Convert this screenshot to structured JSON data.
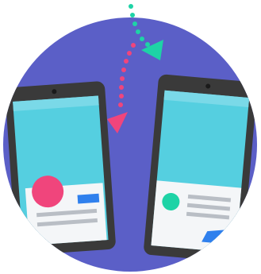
{
  "illustration": {
    "subject": "two-phones-sync",
    "colors": {
      "background": "#ffffff",
      "circle": "#5b5fc7",
      "phone_body": "#3a3a3a",
      "screen": "#55cfe0",
      "card": "#f4f6f8",
      "card_line": "#b9bec5",
      "pink": "#f0457c",
      "teal": "#1ed3a6",
      "blue": "#2f80ed"
    },
    "icons": {
      "arrow_down": "pink-dotted-arrow-icon",
      "arrow_up": "teal-dotted-arrow-icon"
    }
  }
}
